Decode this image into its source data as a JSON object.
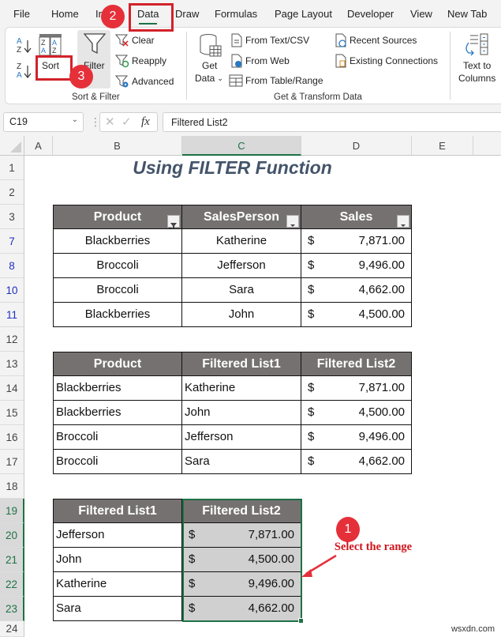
{
  "menu": {
    "tabs": [
      {
        "label": "File"
      },
      {
        "label": "Home"
      },
      {
        "label": "In"
      },
      {
        "label": "Data",
        "active": true
      },
      {
        "label": "Draw"
      },
      {
        "label": "Formulas"
      },
      {
        "label": "Page Layout"
      },
      {
        "label": "Developer"
      },
      {
        "label": "View"
      },
      {
        "label": "New Tab"
      }
    ]
  },
  "ribbon": {
    "sort_filter": {
      "sort_az": "A→Z",
      "sort_za": "Z→A",
      "sort_label": "Sort",
      "filter_label": "Filter",
      "clear_label": "Clear",
      "reapply_label": "Reapply",
      "advanced_label": "Advanced",
      "group_label": "Sort & Filter"
    },
    "get_transform": {
      "get_data_line1": "Get",
      "get_data_line2": "Data",
      "from_text_csv": "From Text/CSV",
      "from_web": "From Web",
      "from_table_range": "From Table/Range",
      "recent_sources": "Recent Sources",
      "existing_connections": "Existing Connections",
      "group_label": "Get & Transform Data"
    },
    "text_to_columns_line1": "Text to",
    "text_to_columns_line2": "Columns"
  },
  "formula_bar": {
    "name_box": "C19",
    "formula": "Filtered List2",
    "fx": "fx"
  },
  "columns": [
    "A",
    "B",
    "C",
    "D",
    "E"
  ],
  "selected_column": "C",
  "rows": [
    {
      "num": "1"
    },
    {
      "num": "2"
    },
    {
      "num": "3"
    },
    {
      "num": "7",
      "filtered": true
    },
    {
      "num": "8",
      "filtered": true
    },
    {
      "num": "10",
      "filtered": true
    },
    {
      "num": "11",
      "filtered": true
    },
    {
      "num": "12"
    },
    {
      "num": "13"
    },
    {
      "num": "14"
    },
    {
      "num": "15"
    },
    {
      "num": "16"
    },
    {
      "num": "17"
    },
    {
      "num": "18"
    },
    {
      "num": "19",
      "selected": true
    },
    {
      "num": "20",
      "selected": true
    },
    {
      "num": "21",
      "selected": true
    },
    {
      "num": "22",
      "selected": true
    },
    {
      "num": "23",
      "selected": true
    },
    {
      "num": "24"
    }
  ],
  "sheet": {
    "title": "Using FILTER Function",
    "table1": {
      "headers": [
        "Product",
        "SalesPerson",
        "Sales"
      ],
      "rows": [
        {
          "product": "Blackberries",
          "person": "Katherine",
          "cur": "$",
          "sales": "7,871.00"
        },
        {
          "product": "Broccoli",
          "person": "Jefferson",
          "cur": "$",
          "sales": "9,496.00"
        },
        {
          "product": "Broccoli",
          "person": "Sara",
          "cur": "$",
          "sales": "4,662.00"
        },
        {
          "product": "Blackberries",
          "person": "John",
          "cur": "$",
          "sales": "4,500.00"
        }
      ]
    },
    "table2": {
      "headers": [
        "Product",
        "Filtered List1",
        "Filtered List2"
      ],
      "rows": [
        {
          "product": "Blackberries",
          "person": "Katherine",
          "cur": "$",
          "sales": "7,871.00"
        },
        {
          "product": "Blackberries",
          "person": "John",
          "cur": "$",
          "sales": "4,500.00"
        },
        {
          "product": "Broccoli",
          "person": "Jefferson",
          "cur": "$",
          "sales": "9,496.00"
        },
        {
          "product": "Broccoli",
          "person": "Sara",
          "cur": "$",
          "sales": "4,662.00"
        }
      ]
    },
    "table3": {
      "headers": [
        "Filtered List1",
        "Filtered List2"
      ],
      "rows": [
        {
          "person": "Jefferson",
          "cur": "$",
          "sales": "7,871.00"
        },
        {
          "person": "John",
          "cur": "$",
          "sales": "4,500.00"
        },
        {
          "person": "Katherine",
          "cur": "$",
          "sales": "9,496.00"
        },
        {
          "person": "Sara",
          "cur": "$",
          "sales": "4,662.00"
        }
      ]
    }
  },
  "annotations": {
    "step1": "1",
    "step1_text": "Select the range",
    "step2": "2",
    "step3": "3"
  },
  "colors": {
    "accent": "#1e7145",
    "header_fill": "#767171",
    "callout": "#e5303a",
    "title": "#44546a"
  },
  "watermark": "wsxdn.com"
}
